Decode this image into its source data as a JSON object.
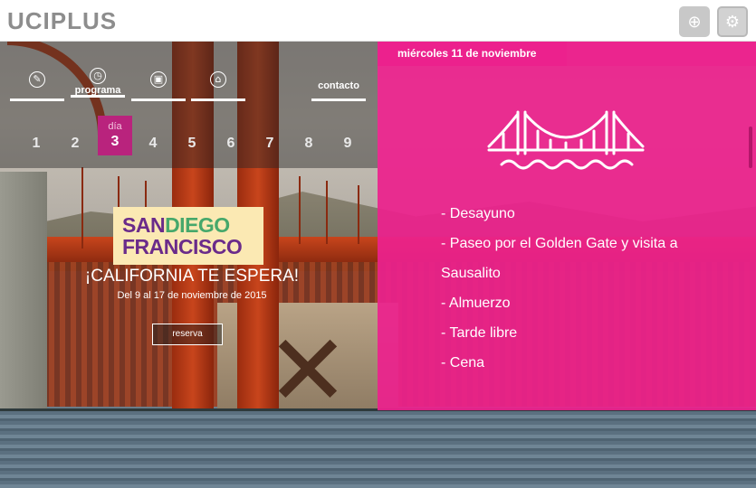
{
  "brand": {
    "logo_text": "UCIPLUS"
  },
  "top_actions": [
    {
      "name": "add-user-icon",
      "glyph": "⊕"
    },
    {
      "name": "settings-icon",
      "glyph": "⚙"
    }
  ],
  "nav": {
    "items": [
      {
        "icon": "pencil-icon",
        "glyph": "✎",
        "label": ""
      },
      {
        "icon": "clock-icon",
        "glyph": "◷",
        "label": "programa"
      },
      {
        "icon": "building-icon",
        "glyph": "▣",
        "label": ""
      },
      {
        "icon": "home-icon",
        "glyph": "⌂",
        "label": ""
      },
      {
        "icon": "",
        "glyph": "",
        "label": "contacto"
      }
    ]
  },
  "days": {
    "label": "día",
    "numbers": [
      "1",
      "2",
      "3",
      "4",
      "5",
      "6",
      "7",
      "8",
      "9"
    ],
    "active": "3"
  },
  "promo": {
    "logo_line1_a": "SAN",
    "logo_line1_b": "DIEGO",
    "logo_line2": "FRANCISCO",
    "tagline": "¡CALIFORNIA TE ESPERA!",
    "dates": "Del 9 al 17 de noviembre de 2015",
    "reserve_label": "reserva"
  },
  "panel": {
    "date_label": "miércoles 11 de noviembre",
    "icon": "golden-gate-bridge-icon",
    "itinerary": [
      "- Desayuno",
      "- Paseo por el Golden Gate y visita a",
      "Sausalito",
      "- Almuerzo",
      "- Tarde libre",
      "- Cena"
    ]
  },
  "colors": {
    "accent_pink": "#ec218d",
    "active_day": "#b9237d",
    "logo_gray": "#8d8d8d"
  }
}
